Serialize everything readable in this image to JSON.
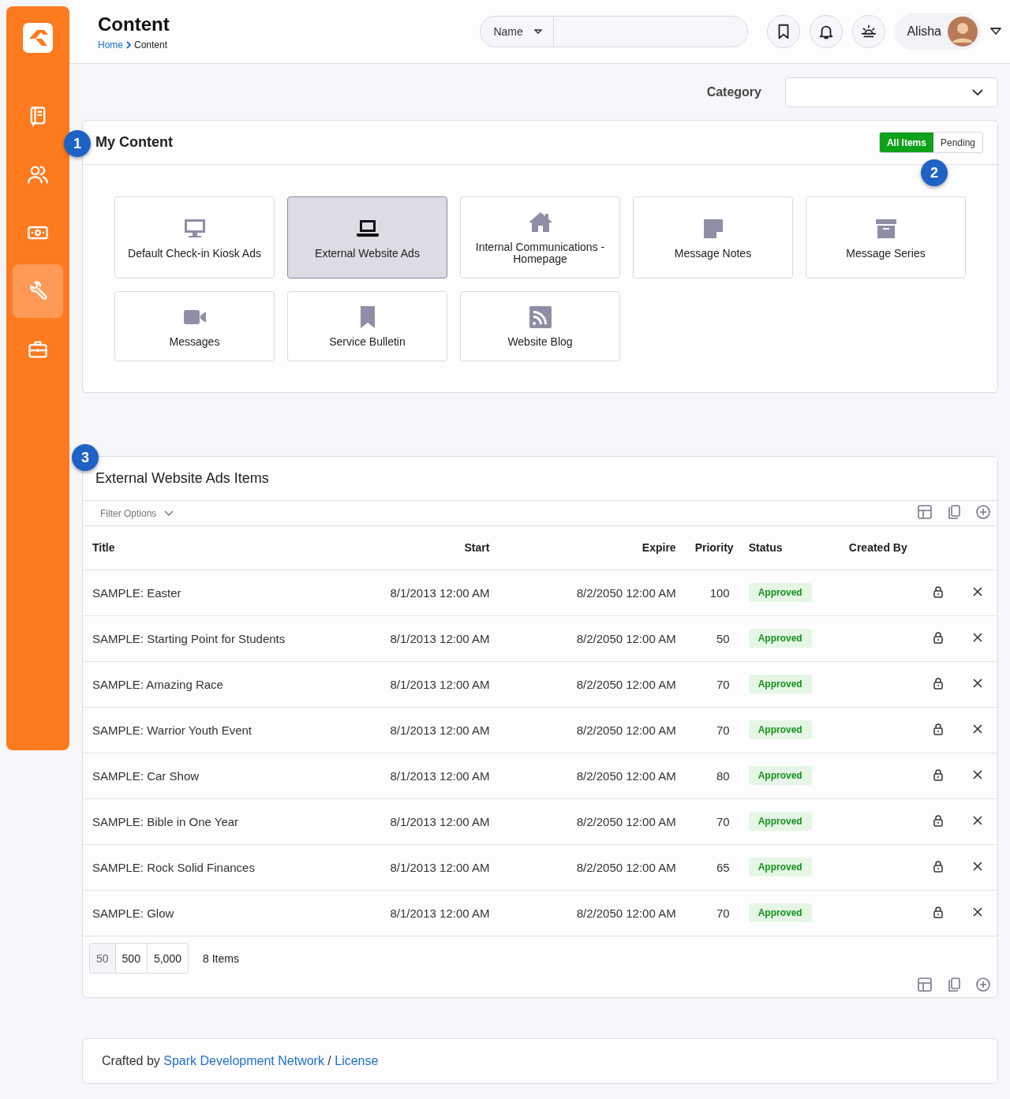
{
  "sidebar": {
    "items": [
      {
        "kind": "book",
        "selected": false
      },
      {
        "kind": "people",
        "selected": false
      },
      {
        "kind": "money",
        "selected": false
      },
      {
        "kind": "wrench",
        "selected": true
      },
      {
        "kind": "briefcase",
        "selected": false
      }
    ]
  },
  "header": {
    "title": "Content",
    "breadcrumb": [
      "Home",
      "Content"
    ],
    "search": {
      "filter": "Name"
    },
    "user": {
      "name": "Alisha"
    }
  },
  "category": {
    "label": "Category"
  },
  "my_content": {
    "marker": "1",
    "title": "My Content",
    "filter_marker": "2",
    "filter_tabs": [
      {
        "label": "All Items",
        "selected": true
      },
      {
        "label": "Pending",
        "selected": false
      }
    ],
    "tiles": [
      {
        "label": "Default Check-in Kiosk Ads",
        "kind": "monitor",
        "selected": false
      },
      {
        "label": "External Website Ads",
        "kind": "laptop",
        "selected": true
      },
      {
        "label": "Internal Communications - Homepage",
        "kind": "home",
        "selected": false
      },
      {
        "label": "Message Notes",
        "kind": "note",
        "selected": false
      },
      {
        "label": "Message Series",
        "kind": "archive",
        "selected": false
      },
      {
        "label": "Messages",
        "kind": "video",
        "selected": false
      },
      {
        "label": "Service Bulletin",
        "kind": "bookmark",
        "selected": false
      },
      {
        "label": "Website Blog",
        "kind": "rss",
        "selected": false
      }
    ]
  },
  "items": {
    "marker": "3",
    "title": "External Website Ads Items",
    "filter_label": "Filter Options",
    "columns": [
      "Title",
      "Start",
      "Expire",
      "Priority",
      "Status",
      "Created By"
    ],
    "rows": [
      {
        "title": "SAMPLE: Easter",
        "start": "8/1/2013 12:00 AM",
        "expire": "8/2/2050 12:00 AM",
        "priority": "100",
        "status": "Approved"
      },
      {
        "title": "SAMPLE: Starting Point for Students",
        "start": "8/1/2013 12:00 AM",
        "expire": "8/2/2050 12:00 AM",
        "priority": "50",
        "status": "Approved"
      },
      {
        "title": "SAMPLE: Amazing Race",
        "start": "8/1/2013 12:00 AM",
        "expire": "8/2/2050 12:00 AM",
        "priority": "70",
        "status": "Approved"
      },
      {
        "title": "SAMPLE: Warrior Youth Event",
        "start": "8/1/2013 12:00 AM",
        "expire": "8/2/2050 12:00 AM",
        "priority": "70",
        "status": "Approved"
      },
      {
        "title": "SAMPLE: Car Show",
        "start": "8/1/2013 12:00 AM",
        "expire": "8/2/2050 12:00 AM",
        "priority": "80",
        "status": "Approved"
      },
      {
        "title": "SAMPLE: Bible in One Year",
        "start": "8/1/2013 12:00 AM",
        "expire": "8/2/2050 12:00 AM",
        "priority": "70",
        "status": "Approved"
      },
      {
        "title": "SAMPLE: Rock Solid Finances",
        "start": "8/1/2013 12:00 AM",
        "expire": "8/2/2050 12:00 AM",
        "priority": "65",
        "status": "Approved"
      },
      {
        "title": "SAMPLE: Glow",
        "start": "8/1/2013 12:00 AM",
        "expire": "8/2/2050 12:00 AM",
        "priority": "70",
        "status": "Approved"
      }
    ],
    "page_sizes": [
      {
        "label": "50",
        "selected": true
      },
      {
        "label": "500",
        "selected": false
      },
      {
        "label": "5,000",
        "selected": false
      }
    ],
    "count": "8 Items"
  },
  "footer": {
    "prefix": "Crafted by",
    "links": [
      "Spark Development Network",
      "License"
    ],
    "separator": "/"
  }
}
